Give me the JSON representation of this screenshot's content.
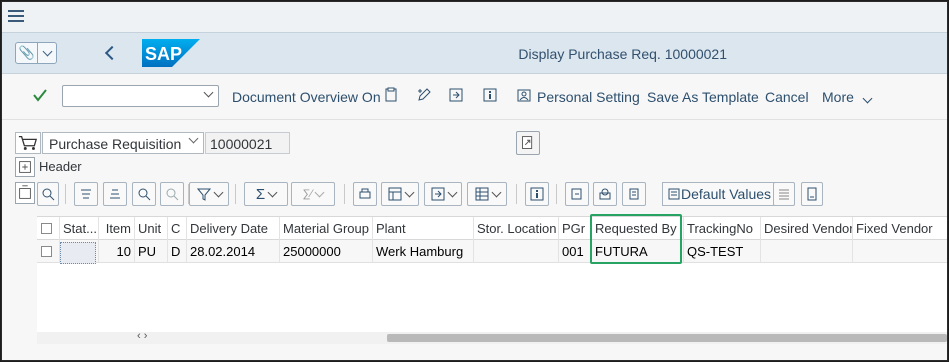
{
  "shell": {
    "title": "Display Purchase Req. 10000021",
    "logo_text": "SAP"
  },
  "toolbar": {
    "command_value": "",
    "document_overview": "Document Overview On",
    "personal_setting": "Personal Setting",
    "save_as_template": "Save As Template",
    "cancel": "Cancel",
    "more": "More"
  },
  "header": {
    "doc_type": "Purchase Requisition",
    "doc_number": "10000021",
    "header_label": "Header"
  },
  "grid_toolbar": {
    "default_values": "Default Values"
  },
  "table": {
    "columns": [
      "Stat...",
      "Item",
      "Unit",
      "C",
      "Delivery Date",
      "Material Group",
      "Plant",
      "Stor. Location",
      "PGr",
      "Requested By",
      "TrackingNo",
      "Desired Vendor",
      "Fixed Vendor"
    ],
    "rows": [
      {
        "status": "",
        "item": "10",
        "unit": "PU",
        "c": "D",
        "delivery_date": "28.02.2014",
        "material_group": "25000000",
        "plant": "Werk Hamburg",
        "stor_location": "",
        "pgr": "001",
        "requested_by": "FUTURA",
        "tracking_no": "QS-TEST",
        "desired_vendor": "",
        "fixed_vendor": ""
      }
    ],
    "scroll_arrows": "‹ ›"
  },
  "colors": {
    "shell_bg": "#dbe6ef",
    "highlight": "#27a363",
    "link": "#2d4f6e",
    "check": "#2b8a3e"
  },
  "icons": [
    "menu-icon",
    "paperclip-icon",
    "back-icon",
    "check-icon",
    "display-document-icon",
    "edit-icon",
    "export-icon",
    "info-icon",
    "personal-setting-icon",
    "shopping-cart-icon"
  ]
}
